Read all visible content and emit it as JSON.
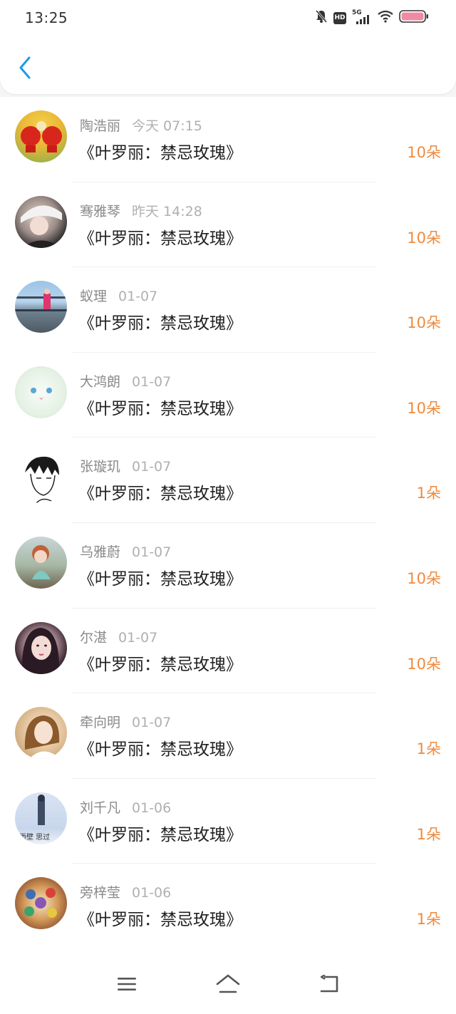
{
  "status_bar": {
    "time": "13:25",
    "icons": [
      "mute-bell-icon",
      "hd-icon",
      "5g-signal-icon",
      "wifi-icon",
      "battery-icon"
    ],
    "hd_label": "HD",
    "network_label": "5G"
  },
  "header": {
    "back_icon": "chevron-left-icon",
    "accent_color": "#1e9be8"
  },
  "gifts": [
    {
      "name": "陶浩丽",
      "time": "今天 07:15",
      "title": "《叶罗丽：禁忌玫瑰》",
      "count": "10朵"
    },
    {
      "name": "骞雅琴",
      "time": "昨天 14:28",
      "title": "《叶罗丽：禁忌玫瑰》",
      "count": "10朵"
    },
    {
      "name": "蚁理",
      "time": "01-07",
      "title": "《叶罗丽：禁忌玫瑰》",
      "count": "10朵"
    },
    {
      "name": "大鸿朗",
      "time": "01-07",
      "title": "《叶罗丽：禁忌玫瑰》",
      "count": "10朵"
    },
    {
      "name": "张璇玑",
      "time": "01-07",
      "title": "《叶罗丽：禁忌玫瑰》",
      "count": "1朵"
    },
    {
      "name": "乌雅蔚",
      "time": "01-07",
      "title": "《叶罗丽：禁忌玫瑰》",
      "count": "10朵"
    },
    {
      "name": "尔湛",
      "time": "01-07",
      "title": "《叶罗丽：禁忌玫瑰》",
      "count": "10朵"
    },
    {
      "name": "牵向明",
      "time": "01-07",
      "title": "《叶罗丽：禁忌玫瑰》",
      "count": "1朵"
    },
    {
      "name": "刘千凡",
      "time": "01-06",
      "title": "《叶罗丽：禁忌玫瑰》",
      "count": "1朵"
    },
    {
      "name": "旁梓莹",
      "time": "01-06",
      "title": "《叶罗丽：禁忌玫瑰》",
      "count": "1朵"
    }
  ],
  "nav_bar": {
    "icons": [
      "menu-icon",
      "home-icon",
      "back-icon"
    ]
  },
  "colors": {
    "count": "#f08a3c",
    "name": "#8a8a8a",
    "title": "#222222"
  }
}
